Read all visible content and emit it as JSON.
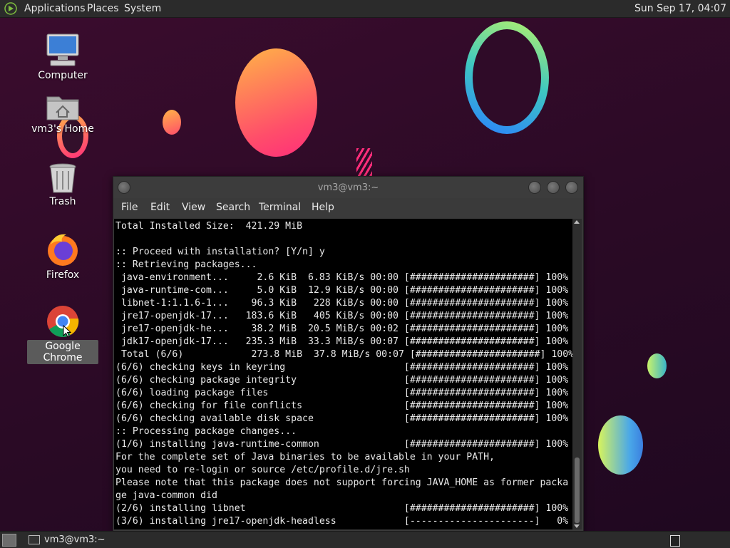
{
  "top_panel": {
    "menus": [
      "Applications",
      "Places",
      "System"
    ],
    "clock": "Sun Sep 17, 04:07"
  },
  "desktop": {
    "icons": [
      {
        "label": "Computer",
        "icon": "computer-icon"
      },
      {
        "label": "vm3's Home",
        "icon": "home-folder-icon"
      },
      {
        "label": "Trash",
        "icon": "trash-icon"
      },
      {
        "label": "Firefox",
        "icon": "firefox-icon"
      },
      {
        "label": "Google Chrome",
        "icon": "chrome-icon",
        "selected": true
      }
    ]
  },
  "terminal": {
    "title": "vm3@vm3:~",
    "menus": [
      "File",
      "Edit",
      "View",
      "Search",
      "Terminal",
      "Help"
    ],
    "lines": [
      "Total Installed Size:  421.29 MiB",
      "",
      ":: Proceed with installation? [Y/n] y",
      ":: Retrieving packages...",
      " java-environment...     2.6 KiB  6.83 KiB/s 00:00 [######################] 100%",
      " java-runtime-com...     5.0 KiB  12.9 KiB/s 00:00 [######################] 100%",
      " libnet-1:1.1.6-1...    96.3 KiB   228 KiB/s 00:00 [######################] 100%",
      " jre17-openjdk-17...   183.6 KiB   405 KiB/s 00:00 [######################] 100%",
      " jre17-openjdk-he...    38.2 MiB  20.5 MiB/s 00:02 [######################] 100%",
      " jdk17-openjdk-17...   235.3 MiB  33.3 MiB/s 00:07 [######################] 100%",
      " Total (6/6)            273.8 MiB  37.8 MiB/s 00:07 [######################] 100%",
      "(6/6) checking keys in keyring                     [######################] 100%",
      "(6/6) checking package integrity                   [######################] 100%",
      "(6/6) loading package files                        [######################] 100%",
      "(6/6) checking for file conflicts                  [######################] 100%",
      "(6/6) checking available disk space                [######################] 100%",
      ":: Processing package changes...",
      "(1/6) installing java-runtime-common               [######################] 100%",
      "For the complete set of Java binaries to be available in your PATH,",
      "you need to re-login or source /etc/profile.d/jre.sh",
      "Please note that this package does not support forcing JAVA_HOME as former packa",
      "ge java-common did",
      "(2/6) installing libnet                            [######################] 100%",
      "(3/6) installing jre17-openjdk-headless            [----------------------]   0%"
    ]
  },
  "taskbar": {
    "window_label": "vm3@vm3:~"
  },
  "colors": {
    "desktop_bg": "#2a0a25",
    "panel_bg": "#2b2b2b",
    "terminal_bg": "#000000",
    "terminal_fg": "#e8e8e8"
  }
}
